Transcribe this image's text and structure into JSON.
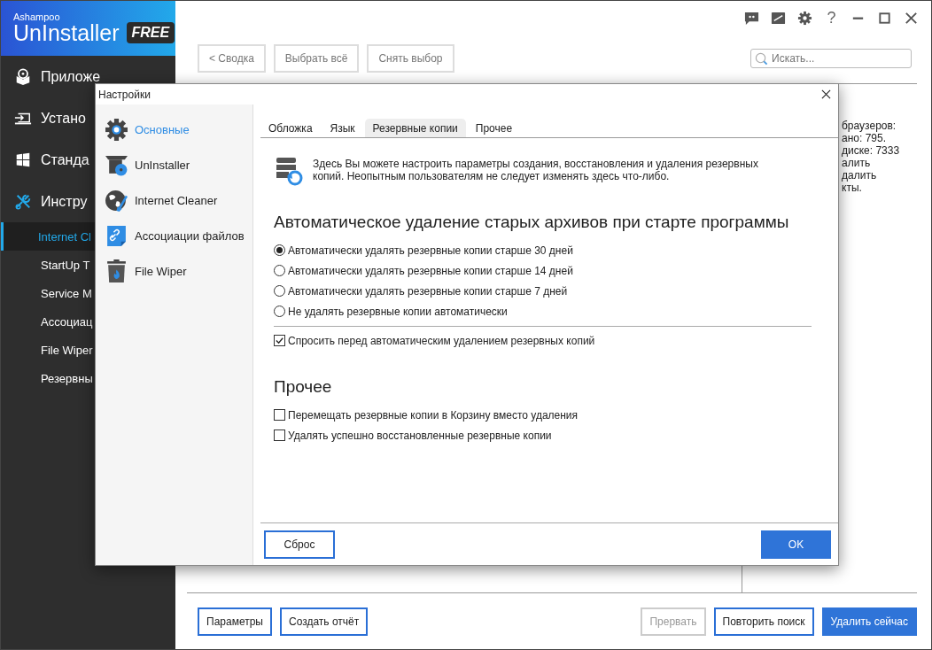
{
  "app": {
    "brand": "Ashampoo",
    "product": "UnInstaller",
    "edition": "FREE",
    "help": "?",
    "nav": [
      {
        "kind": "section",
        "label": "Приложе",
        "selected": false
      },
      {
        "kind": "section",
        "label": "Устано",
        "selected": false
      },
      {
        "kind": "section",
        "label": "Станда",
        "selected": false
      },
      {
        "kind": "section",
        "label": "Инстру",
        "selected": true
      },
      {
        "kind": "sub",
        "label": "Internet Cl",
        "selected": true
      },
      {
        "kind": "sub",
        "label": "StartUp T",
        "selected": false
      },
      {
        "kind": "sub",
        "label": "Service M",
        "selected": false
      },
      {
        "kind": "sub",
        "label": "Ассоциац",
        "selected": false
      },
      {
        "kind": "sub",
        "label": "File Wiper",
        "selected": false
      },
      {
        "kind": "sub",
        "label": "Резервны",
        "selected": false
      }
    ],
    "toolbar": [
      "< Сводка",
      "Выбрать всё",
      "Снять выбор"
    ],
    "search": {
      "placeholder": "Искать..."
    },
    "details": [
      "браузеров:",
      "ано: 795.",
      "диске: 7333",
      "алить",
      "далить",
      "кты."
    ],
    "left_buttons": [
      {
        "label": "Параметры",
        "disabled": false,
        "primary": false
      },
      {
        "label": "Создать отчёт",
        "disabled": false,
        "primary": false
      }
    ],
    "right_buttons": [
      {
        "label": "Прервать",
        "disabled": true,
        "primary": false
      },
      {
        "label": "Повторить поиск",
        "disabled": false,
        "primary": false
      },
      {
        "label": "Удалить сейчас",
        "disabled": false,
        "primary": true
      }
    ]
  },
  "dialog": {
    "title": "Настройки",
    "categories": [
      {
        "label": "Основные",
        "selected": true
      },
      {
        "label": "UnInstaller",
        "selected": false
      },
      {
        "label": "Internet Cleaner",
        "selected": false
      },
      {
        "label": "Ассоциации файлов",
        "selected": false
      },
      {
        "label": "File Wiper",
        "selected": false
      }
    ],
    "tabs": [
      {
        "label": "Обложка",
        "selected": false
      },
      {
        "label": "Язык",
        "selected": false
      },
      {
        "label": "Резервные копии",
        "selected": true
      },
      {
        "label": "Прочее",
        "selected": false
      }
    ],
    "info": "Здесь Вы можете настроить параметры создания, восстановления и удаления резервных копий. Неопытным пользователям не следует изменять здесь что-либо.",
    "sections": [
      {
        "heading": "Автоматическое удаление старых архивов при старте программы",
        "options": [
          {
            "kind": "radio",
            "label": "Автоматически удалять резервные копии старше 30 дней",
            "on": true
          },
          {
            "kind": "radio",
            "label": "Автоматически удалять резервные копии старше 14 дней",
            "on": false
          },
          {
            "kind": "radio",
            "label": "Автоматически удалять резервные копии старше 7 дней",
            "on": false
          },
          {
            "kind": "radio",
            "label": "Не удалять резервные копии автоматически",
            "on": false
          },
          {
            "kind": "checkbox",
            "label": "Спросить перед автоматическим удалением резервных копий",
            "on": true
          }
        ]
      },
      {
        "heading": "Прочее",
        "options": [
          {
            "kind": "checkbox",
            "label": "Перемещать резервные копии в Корзину вместо удаления",
            "on": false
          },
          {
            "kind": "checkbox",
            "label": "Удалять успешно восстановленные резервные копии",
            "on": false
          }
        ]
      }
    ],
    "reset": "Сброс",
    "ok": "OK"
  }
}
